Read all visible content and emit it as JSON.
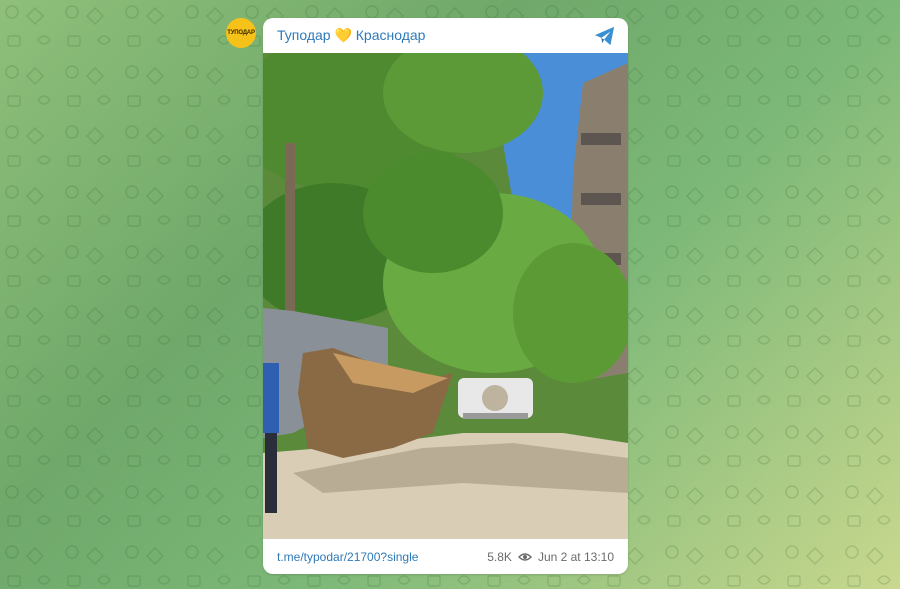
{
  "channel": {
    "name": "Туподар 💛 Краснодар",
    "avatar_text": "ТУПОДАР",
    "logo_icon": "telegram-icon"
  },
  "post": {
    "link": "t.me/typodar/21700?single",
    "views": "5.8K",
    "view_icon": "eye-icon",
    "date": "Jun 2 at 13:10"
  },
  "colors": {
    "accent": "#2f7ab8",
    "avatar_bg": "#f6c21a",
    "background": "#7cb878"
  }
}
